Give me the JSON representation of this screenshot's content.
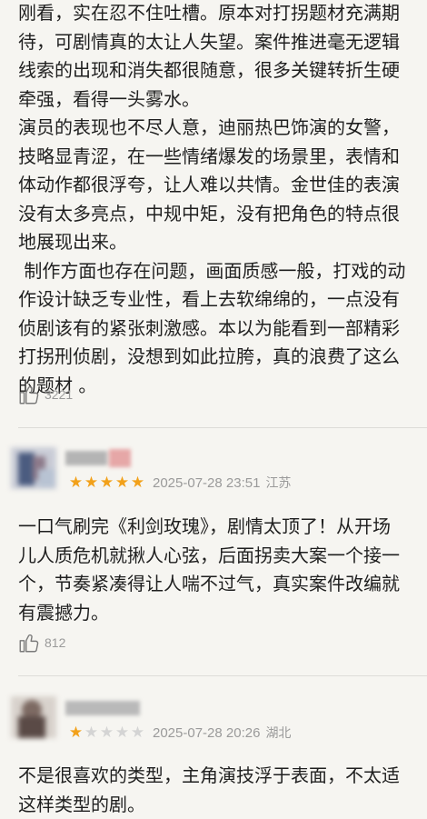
{
  "reviews": [
    {
      "text": "刚看，实在忍不住吐槽。原本对打拐题材充满期\n待，可剧情真的太让人失望。案件推进毫无逻辑\n线索的出现和消失都很随意，很多关键转折生硬\n牵强，看得一头雾水。\n演员的表现也不尽人意，迪丽热巴饰演的女警，\n技略显青涩，在一些情绪爆发的场景里，表情和\n体动作都很浮夸，让人难以共情。金世佳的表演\n没有太多亮点，中规中矩，没有把角色的特点很\n地展现出来。\n 制作方面也存在问题，画面质感一般，打戏的动\n作设计缺乏专业性，看上去软绵绵的，一点没有\n侦剧该有的紧张刺激感。本以为能看到一部精彩\n打拐刑侦剧，没想到如此拉胯，真的浪费了这么\n的题材 。",
      "likes": "3221"
    },
    {
      "rating": 5,
      "date": "2025-07-28 23:51",
      "region": "江苏",
      "text": "一口气刷完《利剑玫瑰》，剧情太顶了！从开场\n儿人质危机就揪人心弦，后面拐卖大案一个接一\n个，节奏紧凑得让人喘不过气，真实案件改编就\n有震撼力。",
      "likes": "812"
    },
    {
      "rating": 1,
      "date": "2025-07-28 20:26",
      "region": "湖北",
      "text": "不是很喜欢的类型，主角演技浮于表面，不太适\n这样类型的剧。"
    }
  ],
  "icons": {
    "like": "thumbs-up-icon",
    "star": "star-icon"
  },
  "colors": {
    "star_on": "#f2a11a",
    "star_off": "#d4d4d4",
    "meta_text": "#9a9a9a",
    "background": "#f6f5f1"
  }
}
